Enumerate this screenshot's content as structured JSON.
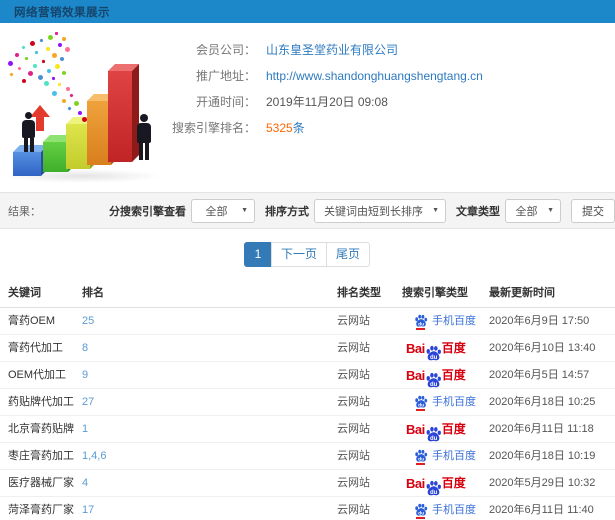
{
  "header": {
    "title": "网络营销效果展示"
  },
  "info": {
    "rows": [
      {
        "label": "会员公司：",
        "value": "山东皇圣堂药业有限公司"
      },
      {
        "label": "推广地址：",
        "value": "http://www.shandonghuangshengtang.cn"
      },
      {
        "label": "开通时间：",
        "value": "2019年11月20日 09:08"
      },
      {
        "label": "搜索引擎排名：",
        "number": "5325",
        "unit": "条"
      }
    ]
  },
  "filters": {
    "result_label": "结果：",
    "engine_label": "分搜索引擎查看",
    "engine_value": "全部",
    "sort_label": "排序方式",
    "sort_value": "关键词由短到长排序",
    "article_label": "文章类型",
    "article_value": "全部",
    "submit_label": "提交"
  },
  "pagination": {
    "current": "1",
    "next": "下一页",
    "last": "尾页"
  },
  "table": {
    "headers": [
      "关键词",
      "排名",
      "排名类型",
      "搜索引擎类型",
      "最新更新时间"
    ],
    "rows": [
      {
        "keyword": "膏药OEM",
        "rank": "25",
        "rank_type": "云网站",
        "engine": "mobile-baidu",
        "updated": "2020年6月9日 17:50"
      },
      {
        "keyword": "膏药代加工",
        "rank": "8",
        "rank_type": "云网站",
        "engine": "baidu",
        "updated": "2020年6月10日 13:40"
      },
      {
        "keyword": "OEM代加工",
        "rank": "9",
        "rank_type": "云网站",
        "engine": "baidu",
        "updated": "2020年6月5日 14:57"
      },
      {
        "keyword": "药贴牌代加工",
        "rank": "27",
        "rank_type": "云网站",
        "engine": "mobile-baidu",
        "updated": "2020年6月18日 10:25"
      },
      {
        "keyword": "北京膏药贴牌",
        "rank": "1",
        "rank_type": "云网站",
        "engine": "baidu",
        "updated": "2020年6月11日 11:18"
      },
      {
        "keyword": "枣庄膏药加工",
        "rank": "1,4,6",
        "rank_type": "云网站",
        "engine": "mobile-baidu",
        "updated": "2020年6月18日 10:19"
      },
      {
        "keyword": "医疗器械厂家",
        "rank": "4",
        "rank_type": "云网站",
        "engine": "baidu",
        "updated": "2020年5月29日 10:32"
      },
      {
        "keyword": "菏泽膏药厂家",
        "rank": "17",
        "rank_type": "云网站",
        "engine": "mobile-baidu",
        "updated": "2020年6月11日 11:40"
      }
    ]
  },
  "engine_labels": {
    "mobile_baidu": "手机百度",
    "baidu_bai": "Bai",
    "baidu_du": "du",
    "baidu_cn": "百度"
  },
  "icons": {
    "select_caret": "▼"
  },
  "colors": {
    "header_bg": "#1c87c9",
    "header_text": "#16456b",
    "link_blue": "#2d7ac0",
    "rank_blue": "#5b9bd5",
    "highlight_orange": "#ff6600",
    "pagination_active": "#337ab7",
    "baidu_red": "#d7000f",
    "baidu_blue": "#2944d6",
    "mobile_text_blue": "#3a6fd8"
  }
}
